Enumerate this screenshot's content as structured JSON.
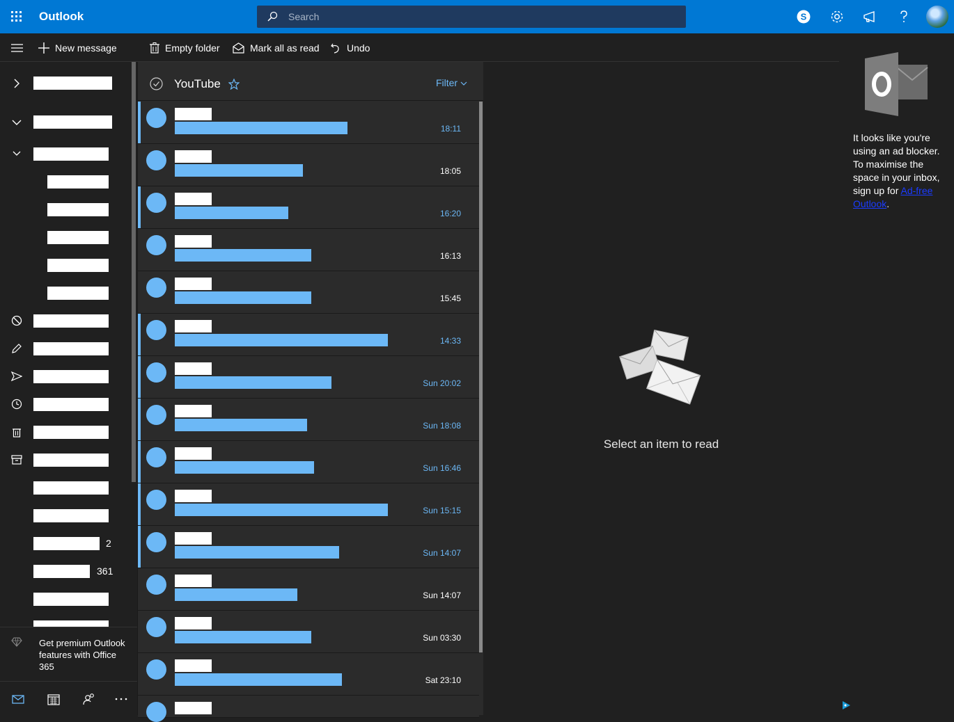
{
  "app": {
    "title": "Outlook"
  },
  "search": {
    "placeholder": "Search"
  },
  "toolbar": {
    "new_message": "New message",
    "empty_folder": "Empty folder",
    "mark_all_read": "Mark all as read",
    "undo": "Undo"
  },
  "nav": {
    "counts": [
      "2",
      "361"
    ],
    "premium": "Get premium Outlook features with Office 365"
  },
  "list": {
    "folder": "YouTube",
    "filter": "Filter",
    "messages": [
      {
        "time": "18:11",
        "unread": true
      },
      {
        "time": "18:05",
        "unread": false
      },
      {
        "time": "16:20",
        "unread": true
      },
      {
        "time": "16:13",
        "unread": false
      },
      {
        "time": "15:45",
        "unread": false
      },
      {
        "time": "14:33",
        "unread": true
      },
      {
        "time": "Sun 20:02",
        "unread": true
      },
      {
        "time": "Sun 18:08",
        "unread": true
      },
      {
        "time": "Sun 16:46",
        "unread": true
      },
      {
        "time": "Sun 15:15",
        "unread": true
      },
      {
        "time": "Sun 14:07",
        "unread": true
      },
      {
        "time": "Sun 14:07",
        "unread": false
      },
      {
        "time": "Sun 03:30",
        "unread": false
      },
      {
        "time": "Sat 23:10",
        "unread": false
      }
    ]
  },
  "reading": {
    "empty": "Select an item to read"
  },
  "ad": {
    "text": "It looks like you're using an ad blocker. To maximise the space in your inbox, sign up for",
    "link": "Ad-free Outlook",
    "suffix": "."
  },
  "colors": {
    "brand": "#0078d4",
    "accent": "#6cb8f6"
  }
}
